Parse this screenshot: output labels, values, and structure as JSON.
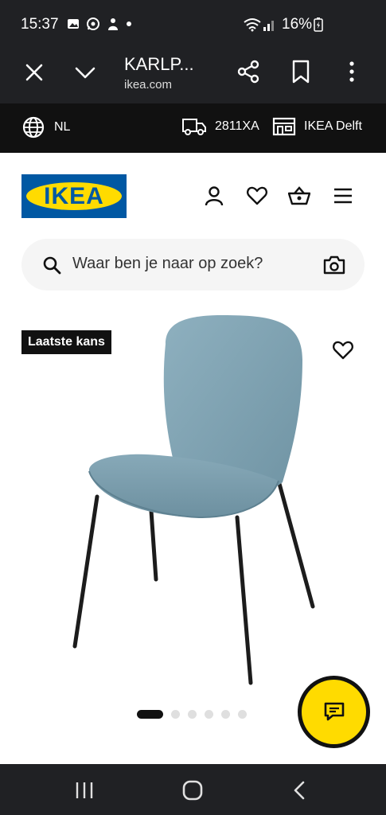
{
  "status_bar": {
    "time": "15:37",
    "battery": "16%",
    "icons": [
      "gallery-icon",
      "whatsapp-icon",
      "person-icon",
      "dot-icon",
      "wifi-icon",
      "signal-icon",
      "battery-charging-icon"
    ]
  },
  "browser_tab": {
    "title": "KARLP...",
    "url": "ikea.com"
  },
  "utility_bar": {
    "language": "NL",
    "postal_code": "2811XA",
    "store": "IKEA Delft"
  },
  "header": {
    "logo_text": "IKEA",
    "brand_blue": "#0058a3",
    "brand_yellow": "#ffdb00"
  },
  "search": {
    "placeholder": "Waar ben je naar op zoek?"
  },
  "product": {
    "badge": "Laatste kans",
    "image_colors": {
      "seat": "#7da1b0",
      "legs": "#1c1c1c"
    }
  },
  "carousel": {
    "total": 6,
    "active_index": 0
  }
}
